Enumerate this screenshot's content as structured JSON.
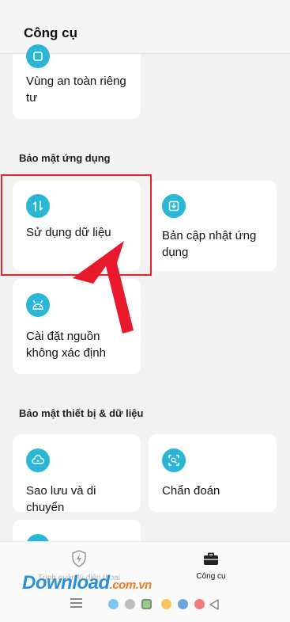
{
  "header": {
    "title": "Công cụ"
  },
  "cards": {
    "private_zone": "Vùng an toàn riêng tư",
    "data_usage": "Sử dụng dữ liệu",
    "app_update": "Bản cập nhật ứng dụng",
    "unknown_sources": "Cài đặt nguồn không xác định",
    "backup": "Sao lưu và di chuyển",
    "diagnosis": "Chẩn đoán"
  },
  "sections": {
    "app_security": "Bảo mật ứng dụng",
    "device_security": "Bảo mật thiết bị & dữ liệu"
  },
  "nav": {
    "phone_manager": "Trình quản lý điện thoại",
    "tools": "Công cụ"
  },
  "watermark": {
    "main": "Download",
    "suffix": ".com.vn"
  },
  "colors": {
    "accent": "#2ab7d5",
    "annotation": "#e3262d"
  }
}
